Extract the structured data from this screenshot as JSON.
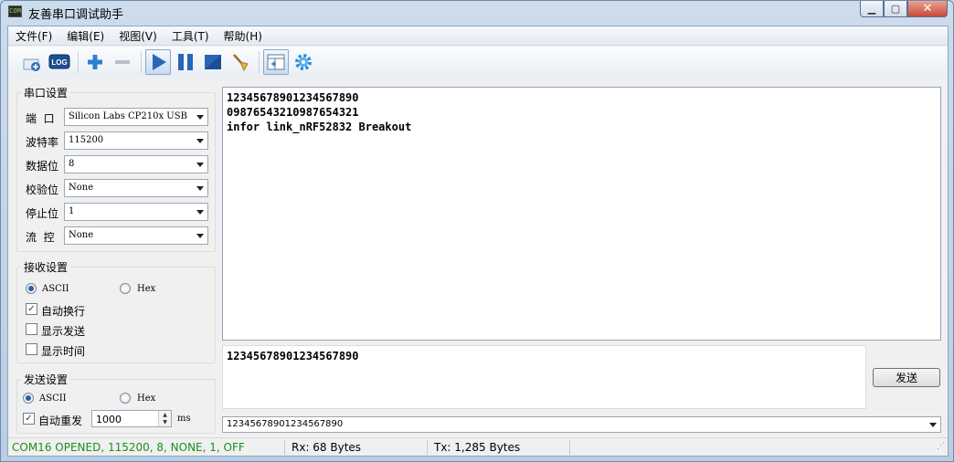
{
  "window": {
    "title": "友善串口调试助手",
    "icon_text": "COM"
  },
  "menu": [
    "文件(F)",
    "编辑(E)",
    "视图(V)",
    "工具(T)",
    "帮助(H)"
  ],
  "toolbar": {
    "log_label": "LOG"
  },
  "serial_settings": {
    "title": "串口设置",
    "port_label": "端  口",
    "port_value": "Silicon Labs CP210x USB",
    "baud_label": "波特率",
    "baud_value": "115200",
    "databits_label": "数据位",
    "databits_value": "8",
    "parity_label": "校验位",
    "parity_value": "None",
    "stopbits_label": "停止位",
    "stopbits_value": "1",
    "flow_label": "流  控",
    "flow_value": "None"
  },
  "receive_settings": {
    "title": "接收设置",
    "ascii_label": "ASCII",
    "hex_label": "Hex",
    "auto_newline_label": "自动换行",
    "show_send_label": "显示发送",
    "show_time_label": "显示时间"
  },
  "send_settings": {
    "title": "发送设置",
    "ascii_label": "ASCII",
    "hex_label": "Hex",
    "auto_resend_label": "自动重发",
    "interval_value": "1000",
    "interval_unit": "ms"
  },
  "receive_area": {
    "lines": [
      "12345678901234567890",
      "09876543210987654321",
      "infor link_nRF52832 Breakout"
    ]
  },
  "send_area": {
    "text": "12345678901234567890",
    "send_button": "发送"
  },
  "history": {
    "selected": "12345678901234567890"
  },
  "status": {
    "connection": "COM16 OPENED, 115200, 8, NONE, 1, OFF",
    "rx": "Rx: 68 Bytes",
    "tx": "Tx: 1,285 Bytes",
    "connection_color": "#1b8f1b"
  }
}
